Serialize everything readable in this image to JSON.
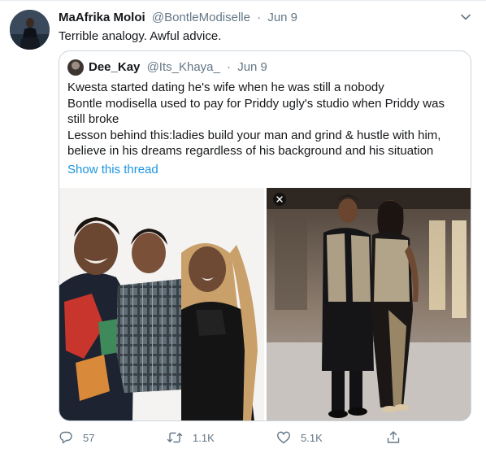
{
  "tweet": {
    "display_name": "MaAfrika Moloi",
    "handle": "@BontleModiselle",
    "separator": "·",
    "date": "Jun 9",
    "text": "Terrible analogy. Awful advice."
  },
  "quote": {
    "display_name": "Dee_Kay",
    "handle": "@Its_Khaya_",
    "separator": "·",
    "date": "Jun 9",
    "lines": [
      "Kwesta started dating he's wife when he was still a nobody",
      "Bontle modisella used to pay for Priddy ugly's studio when Priddy was",
      "still broke",
      "Lesson behind this:ladies build your man and grind & hustle with him,",
      "believe in his dreams regardless of his background and his situation"
    ],
    "show_thread": "Show this thread"
  },
  "actions": {
    "reply_count": "57",
    "retweet_count": "1.1K",
    "like_count": "5.1K"
  },
  "icons": [
    "chevron-down-icon",
    "close-icon",
    "reply-icon",
    "retweet-icon",
    "like-icon",
    "share-icon"
  ],
  "colors": {
    "link": "#1b95e0",
    "secondary_text": "#657786",
    "border": "#ccd6dd"
  }
}
